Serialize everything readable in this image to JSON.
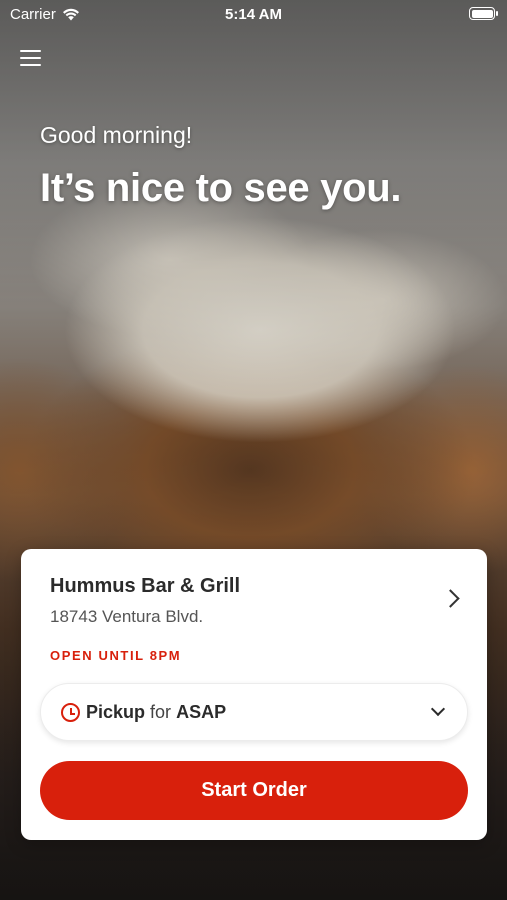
{
  "status_bar": {
    "carrier": "Carrier",
    "time": "5:14 AM",
    "wifi_icon": "wifi-icon",
    "battery_icon": "battery-icon"
  },
  "nav": {
    "menu_icon": "hamburger-menu-icon"
  },
  "hero": {
    "greeting": "Good morning!",
    "headline": "It’s nice to see you."
  },
  "store": {
    "name": "Hummus Bar & Grill",
    "address": "18743 Ventura Blvd.",
    "open_status": "OPEN UNTIL 8PM",
    "chevron_icon": "chevron-right-icon"
  },
  "order_mode": {
    "mode": "Pickup",
    "connector": "for",
    "time": "ASAP",
    "clock_icon": "clock-icon",
    "dropdown_icon": "chevron-down-icon"
  },
  "actions": {
    "start_order_label": "Start Order"
  },
  "colors": {
    "accent": "#d8200c",
    "card_bg": "#ffffff",
    "text_dark": "#2b2b2b"
  }
}
